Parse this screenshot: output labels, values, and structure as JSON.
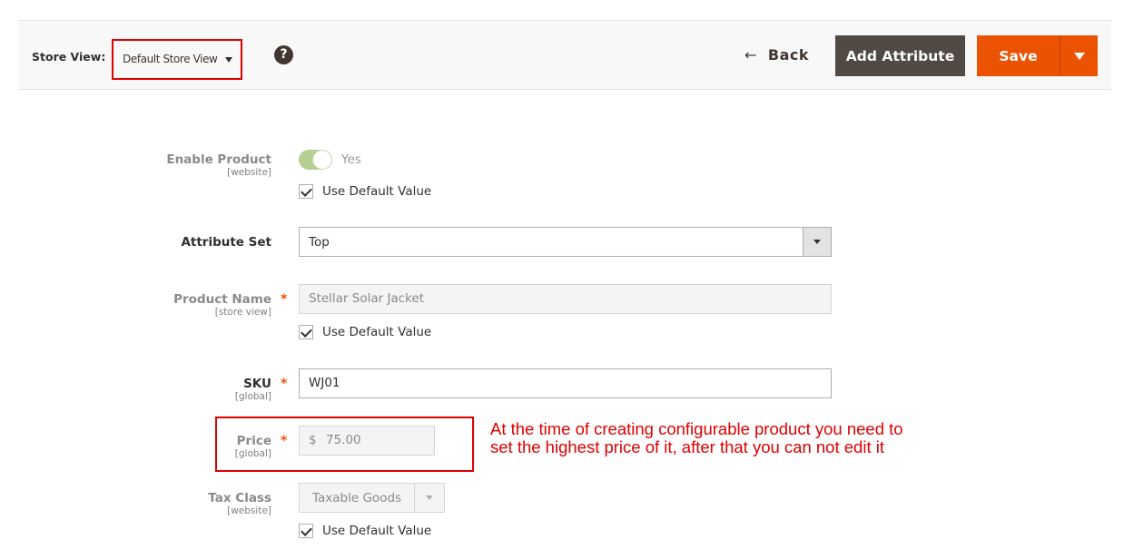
{
  "header": {
    "store_view_label": "Store View:",
    "store_view_value": "Default Store View",
    "help_icon": "?",
    "back_arrow": "←",
    "back_label": "Back",
    "add_attribute_label": "Add Attribute",
    "save_label": "Save"
  },
  "form": {
    "enable_product": {
      "label": "Enable Product",
      "scope": "[website]",
      "value": "Yes",
      "enabled": true,
      "use_default_label": "Use Default Value",
      "use_default_checked": true
    },
    "attribute_set": {
      "label": "Attribute Set",
      "value": "Top"
    },
    "product_name": {
      "label": "Product Name",
      "scope": "[store view]",
      "required": "*",
      "value": "Stellar Solar Jacket",
      "use_default_label": "Use Default Value",
      "use_default_checked": true
    },
    "sku": {
      "label": "SKU",
      "scope": "[global]",
      "required": "*",
      "value": "WJ01"
    },
    "price": {
      "label": "Price",
      "scope": "[global]",
      "required": "*",
      "currency": "$",
      "value": "75.00"
    },
    "tax_class": {
      "label": "Tax Class",
      "scope": "[website]",
      "value": "Taxable Goods",
      "use_default_label": "Use Default Value",
      "use_default_checked": true
    }
  },
  "annotation": {
    "line1": "At the time of creating configurable product you need to",
    "line2": "set the highest price of it, after that you can not edit it"
  },
  "colors": {
    "accent": "#eb5202",
    "secondary_button": "#514943",
    "annotation": "#e00000",
    "toggle_on": "#b5cf93"
  }
}
